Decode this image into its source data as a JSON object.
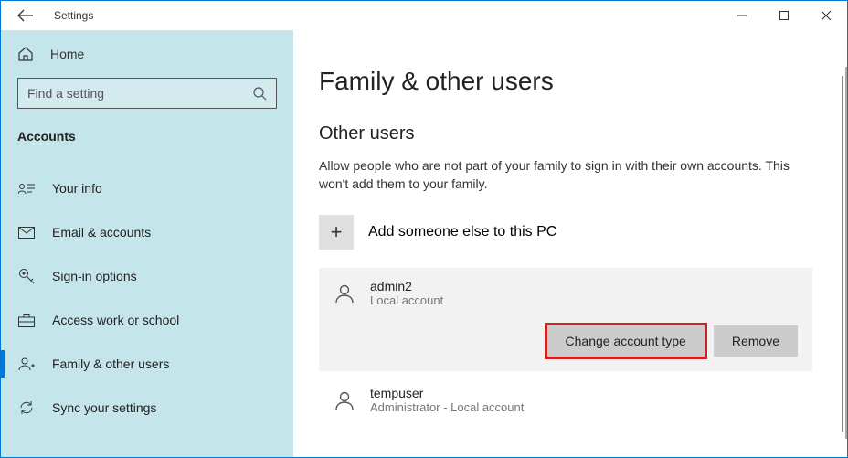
{
  "titlebar": {
    "app": "Settings"
  },
  "sidebar": {
    "home": "Home",
    "search_placeholder": "Find a setting",
    "section": "Accounts",
    "items": [
      {
        "label": "Your info"
      },
      {
        "label": "Email & accounts"
      },
      {
        "label": "Sign-in options"
      },
      {
        "label": "Access work or school"
      },
      {
        "label": "Family & other users"
      },
      {
        "label": "Sync your settings"
      }
    ]
  },
  "main": {
    "title": "Family & other users",
    "section": "Other users",
    "description": "Allow people who are not part of your family to sign in with their own accounts. This won't add them to your family.",
    "add_label": "Add someone else to this PC",
    "users": [
      {
        "name": "admin2",
        "type": "Local account"
      },
      {
        "name": "tempuser",
        "type": "Administrator - Local account"
      }
    ],
    "change_type": "Change account type",
    "remove": "Remove"
  }
}
